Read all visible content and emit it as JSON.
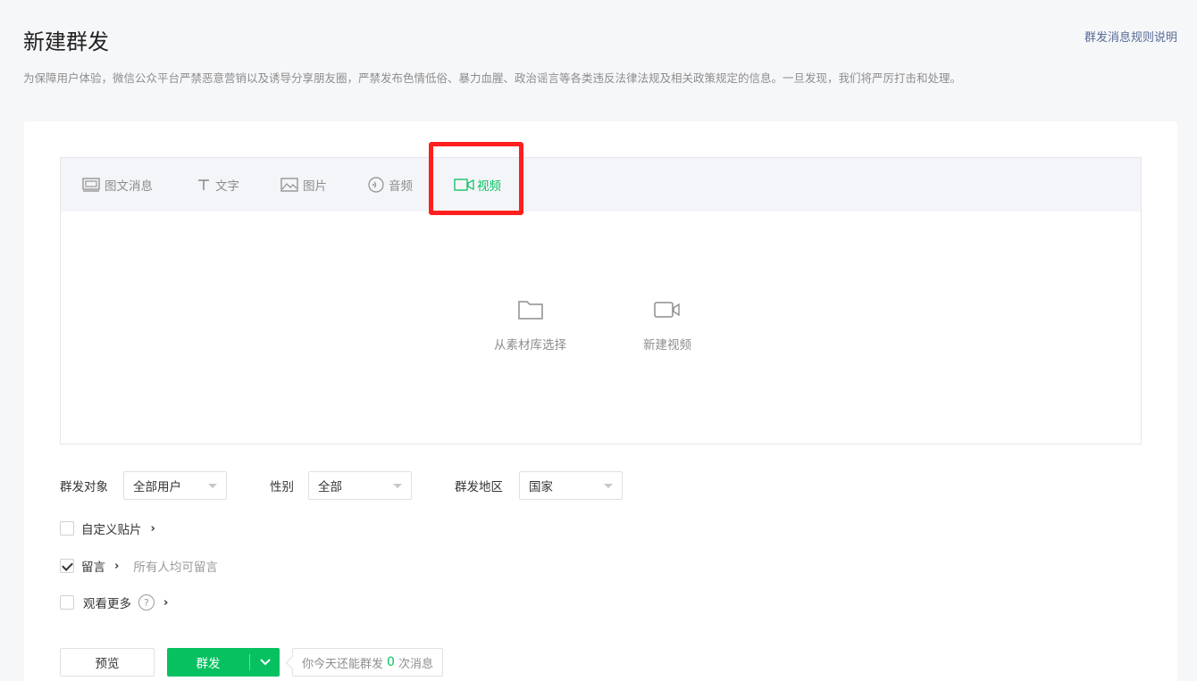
{
  "header": {
    "title": "新建群发",
    "rules_link": "群发消息规则说明",
    "notice": "为保障用户体验，微信公众平台严禁恶意营销以及诱导分享朋友圈，严禁发布色情低俗、暴力血腥、政治谣言等各类违反法律法规及相关政策规定的信息。一旦发现，我们将严厉打击和处理。"
  },
  "tabs": [
    {
      "label": "图文消息",
      "icon": "article-icon"
    },
    {
      "label": "文字",
      "icon": "text-icon"
    },
    {
      "label": "图片",
      "icon": "image-icon"
    },
    {
      "label": "音频",
      "icon": "audio-icon"
    },
    {
      "label": "视频",
      "icon": "video-icon",
      "active": true
    }
  ],
  "editor": {
    "options": [
      {
        "label": "从素材库选择",
        "icon": "folder-icon"
      },
      {
        "label": "新建视频",
        "icon": "video-camera-icon"
      }
    ]
  },
  "filters": {
    "target_label": "群发对象",
    "target_value": "全部用户",
    "gender_label": "性别",
    "gender_value": "全部",
    "region_label": "群发地区",
    "region_value": "国家"
  },
  "options": {
    "custom_sticker": {
      "label": "自定义贴片",
      "checked": false
    },
    "comments": {
      "label": "留言",
      "checked": true,
      "hint": "所有人均可留言"
    },
    "see_more": {
      "label": "观看更多",
      "checked": false
    }
  },
  "actions": {
    "preview_label": "预览",
    "send_label": "群发",
    "quota_prefix": "你今天还能群发",
    "quota_count": "0",
    "quota_suffix": "次消息"
  },
  "colors": {
    "accent": "#07c160",
    "highlight": "#ff1f1f",
    "link": "#576b95"
  }
}
